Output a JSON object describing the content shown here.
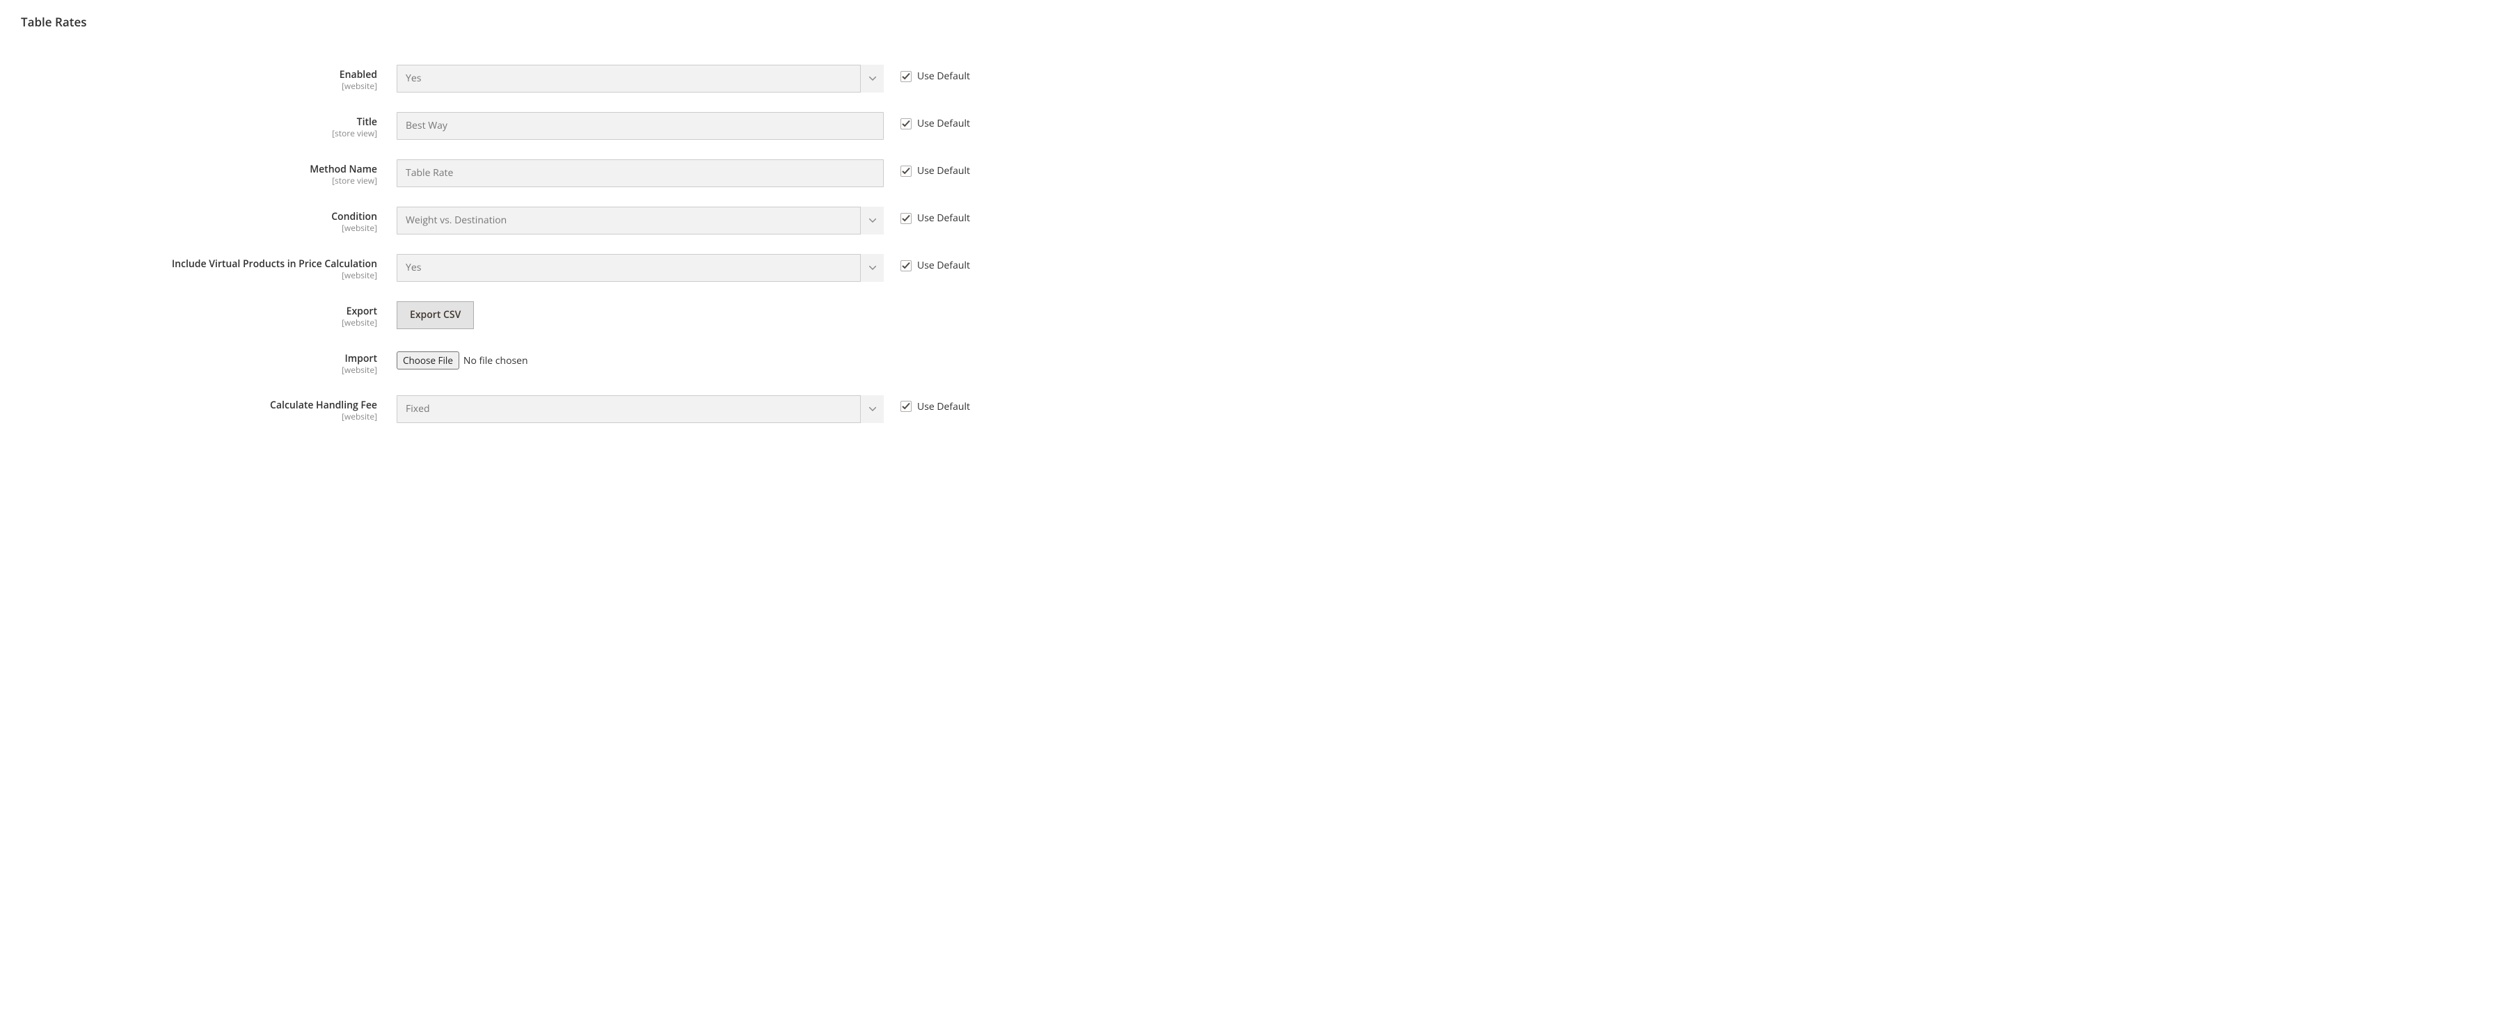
{
  "section": {
    "title": "Table Rates"
  },
  "use_default_label": "Use Default",
  "scopes": {
    "website": "[website]",
    "store_view": "[store view]"
  },
  "fields": {
    "enabled": {
      "label": "Enabled",
      "value": "Yes"
    },
    "title": {
      "label": "Title",
      "value": "Best Way"
    },
    "method": {
      "label": "Method Name",
      "value": "Table Rate"
    },
    "condition": {
      "label": "Condition",
      "value": "Weight vs. Destination"
    },
    "virtual": {
      "label": "Include Virtual Products in Price Calculation",
      "value": "Yes"
    },
    "export": {
      "label": "Export",
      "button": "Export CSV"
    },
    "import": {
      "label": "Import",
      "button": "Choose File",
      "status": "No file chosen"
    },
    "handling": {
      "label": "Calculate Handling Fee",
      "value": "Fixed"
    }
  }
}
